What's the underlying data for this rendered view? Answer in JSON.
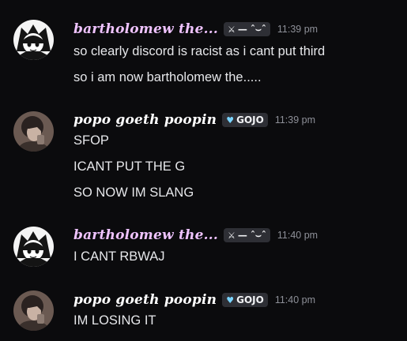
{
  "messages": [
    {
      "username": "bartholomew the...",
      "username_color": "#efc3ff",
      "tag_icon": "sword-icon",
      "tag_label": "— ˆ⌣ˆ",
      "timestamp": "11:39 pm",
      "lines": [
        "so clearly discord is racist as i cant put third",
        "so i am now bartholomew the....."
      ]
    },
    {
      "username": "popo goeth poopin",
      "username_color": "#ffffff",
      "tag_icon": "heart-icon",
      "tag_label": "GOJO",
      "timestamp": "11:39 pm",
      "lines": [
        "SFOP",
        "ICANT PUT THE G",
        "SO NOW IM SLANG"
      ]
    },
    {
      "username": "bartholomew the...",
      "username_color": "#efc3ff",
      "tag_icon": "sword-icon",
      "tag_label": "— ˆ⌣ˆ",
      "timestamp": "11:40 pm",
      "lines": [
        "I CANT RBWAJ"
      ]
    },
    {
      "username": "popo goeth poopin",
      "username_color": "#ffffff",
      "tag_icon": "heart-icon",
      "tag_label": "GOJO",
      "timestamp": "11:40 pm",
      "lines": [
        "IM LOSING IT"
      ]
    }
  ]
}
